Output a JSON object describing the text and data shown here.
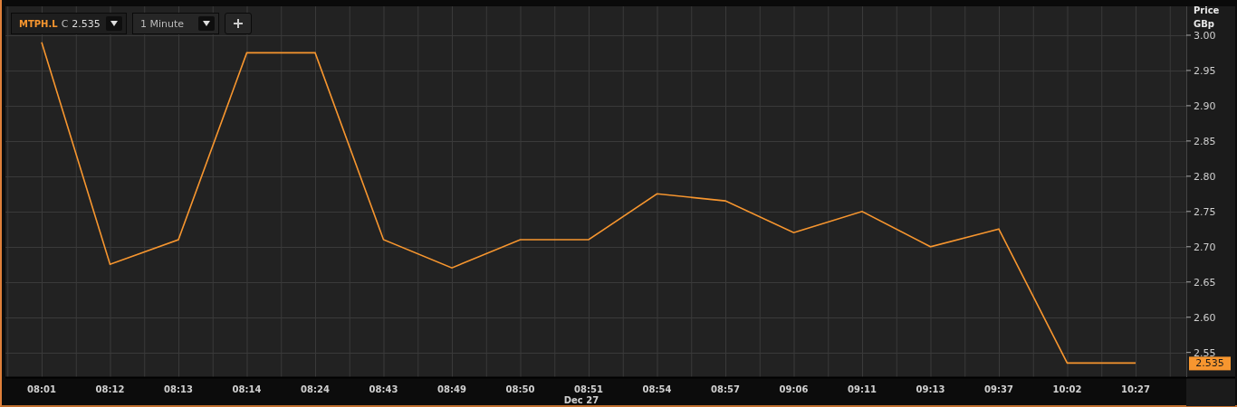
{
  "toolbar": {
    "close_label": "C",
    "close_value": "2.535",
    "interval": "1 Minute"
  },
  "chart": {
    "axis_unit": "GBp",
    "date_label": "Dec 27",
    "last_price": "2.535",
    "chart_data": {
      "type": "line",
      "ylabel": "Price",
      "grid": true,
      "categories": [
        "08:01",
        "08:12",
        "08:13",
        "08:14",
        "08:24",
        "08:43",
        "08:49",
        "08:50",
        "08:51",
        "08:54",
        "08:57",
        "09:06",
        "09:11",
        "09:13",
        "09:37",
        "10:02",
        "10:27"
      ],
      "series": [
        {
          "name": "MTPH.L",
          "color": "#f7962f",
          "values": [
            2.99,
            2.675,
            2.71,
            2.975,
            2.975,
            2.71,
            2.67,
            2.71,
            2.71,
            2.775,
            2.765,
            2.72,
            2.75,
            2.7,
            2.725,
            2.535,
            2.535
          ]
        }
      ],
      "ylim": [
        2.515,
        3.041
      ],
      "yticks": [
        {
          "value": 2.55,
          "label": "2.55"
        },
        {
          "value": 2.6,
          "label": "2.60"
        },
        {
          "value": 2.65,
          "label": "2.65"
        },
        {
          "value": 2.7,
          "label": "2.70"
        },
        {
          "value": 2.75,
          "label": "2.75"
        },
        {
          "value": 2.8,
          "label": "2.80"
        },
        {
          "value": 2.85,
          "label": "2.85"
        },
        {
          "value": 2.9,
          "label": "2.90"
        },
        {
          "value": 2.95,
          "label": "2.95"
        },
        {
          "value": 3.0,
          "label": "3.00"
        }
      ]
    }
  }
}
